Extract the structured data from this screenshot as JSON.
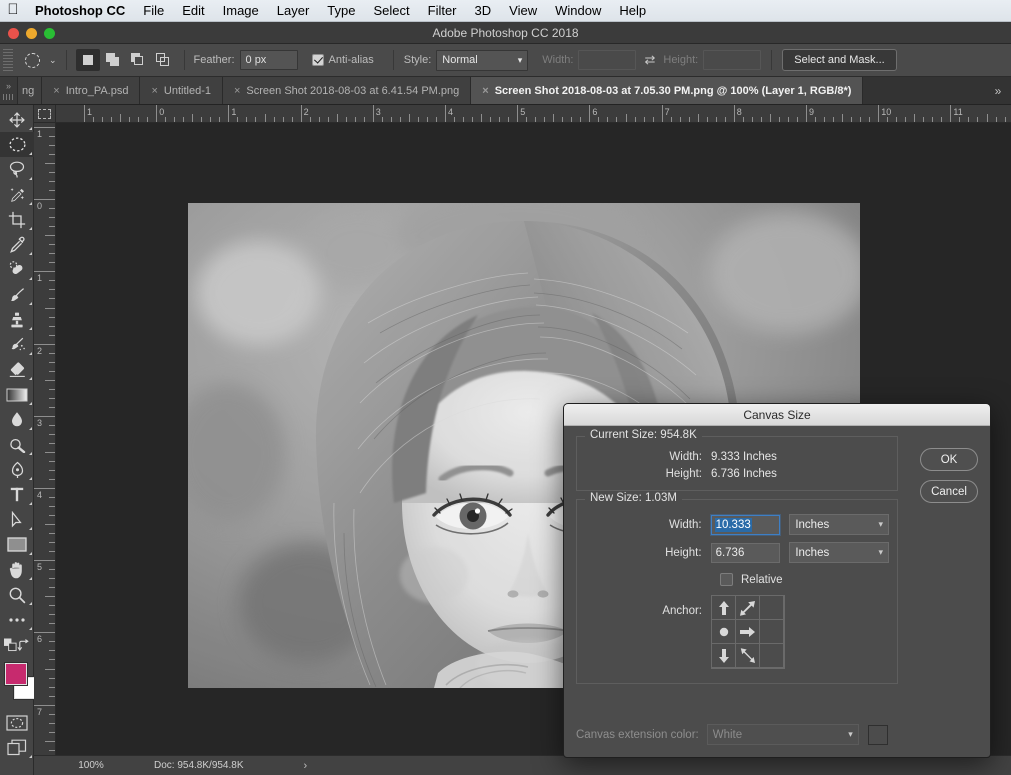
{
  "macmenu": {
    "apple_icon": "apple-logo",
    "items": [
      "Photoshop CC",
      "File",
      "Edit",
      "Image",
      "Layer",
      "Type",
      "Select",
      "Filter",
      "3D",
      "View",
      "Window",
      "Help"
    ]
  },
  "window": {
    "title": "Adobe Photoshop CC 2018",
    "traffic": [
      "close",
      "minimize",
      "zoom"
    ]
  },
  "options_bar": {
    "tool_icon": "elliptical-marquee-icon",
    "tool_chevron": "⌄",
    "selection_modes": [
      "new-selection",
      "add-to-selection",
      "subtract-from-selection",
      "intersect-with-selection"
    ],
    "active_selection_mode": 0,
    "feather_label": "Feather:",
    "feather_value": "0 px",
    "antialias_label": "Anti-alias",
    "antialias_checked": true,
    "style_label": "Style:",
    "style_value": "Normal",
    "width_label": "Width:",
    "width_value": "",
    "swap_icon": "swap-arrows-icon",
    "height_label": "Height:",
    "height_value": "",
    "select_and_mask": "Select and Mask..."
  },
  "tabs": {
    "overflow_left": "»",
    "overflow_right": "»",
    "items": [
      {
        "label": "ng",
        "close": "×",
        "active": false,
        "clipped": true
      },
      {
        "label": "Intro_PA.psd",
        "close": "×",
        "active": false
      },
      {
        "label": "Untitled-1",
        "close": "×",
        "active": false
      },
      {
        "label": "Screen Shot 2018-08-03 at 6.41.54 PM.png",
        "close": "×",
        "active": false
      },
      {
        "label": "Screen Shot 2018-08-03 at 7.05.30 PM.png @ 100% (Layer 1, RGB/8*)",
        "close": "×",
        "active": true
      }
    ]
  },
  "tools": [
    {
      "name": "move-tool",
      "active": false
    },
    {
      "name": "elliptical-marquee-tool",
      "active": true
    },
    {
      "name": "lasso-tool",
      "active": false
    },
    {
      "name": "quick-selection-tool",
      "active": false
    },
    {
      "name": "crop-tool",
      "active": false
    },
    {
      "name": "eyedropper-tool",
      "active": false
    },
    {
      "name": "healing-brush-tool",
      "active": false
    },
    {
      "name": "brush-tool",
      "active": false
    },
    {
      "name": "clone-stamp-tool",
      "active": false
    },
    {
      "name": "history-brush-tool",
      "active": false
    },
    {
      "name": "eraser-tool",
      "active": false
    },
    {
      "name": "gradient-tool",
      "active": false
    },
    {
      "name": "blur-tool",
      "active": false
    },
    {
      "name": "dodge-tool",
      "active": false
    },
    {
      "name": "pen-tool",
      "active": false
    },
    {
      "name": "type-tool",
      "active": false
    },
    {
      "name": "path-selection-tool",
      "active": false
    },
    {
      "name": "rectangle-tool",
      "active": false
    },
    {
      "name": "hand-tool",
      "active": false
    },
    {
      "name": "zoom-tool",
      "active": false
    },
    {
      "name": "edit-toolbar-tool",
      "active": false
    }
  ],
  "colors": {
    "foreground": "#c72a6e",
    "background": "#ffffff",
    "accent_selection": "#2a6ba8",
    "ps_chrome": "#4a4a4a",
    "canvas_backdrop": "#262626"
  },
  "rulers": {
    "units": "inches",
    "horizontal_labels": [
      "1",
      "0",
      "1",
      "2",
      "3",
      "4",
      "5",
      "6",
      "7",
      "8",
      "9",
      "10",
      "11"
    ],
    "vertical_labels": [
      "1",
      "0",
      "1",
      "2",
      "3",
      "4",
      "5",
      "6",
      "7"
    ]
  },
  "canvas": {
    "image_alt": "black-and-white-portrait-of-a-young-girl"
  },
  "status_bar": {
    "zoom": "100%",
    "doc": "Doc: 954.8K/954.8K",
    "arrow": "›"
  },
  "dialog": {
    "title": "Canvas Size",
    "current_size": {
      "legend": "Current Size: 954.8K",
      "rows": [
        {
          "label": "Width:",
          "value": "9.333 Inches"
        },
        {
          "label": "Height:",
          "value": "6.736 Inches"
        }
      ]
    },
    "new_size": {
      "legend": "New Size: 1.03M",
      "width_label": "Width:",
      "width_value": "10.333",
      "width_unit": "Inches",
      "height_label": "Height:",
      "height_value": "6.736",
      "height_unit": "Inches",
      "relative_label": "Relative",
      "relative_checked": false,
      "anchor_label": "Anchor:",
      "anchor_icons": [
        [
          "arrow-up-icon",
          "arrow-up-right-icon",
          ""
        ],
        [
          "anchor-dot-icon",
          "arrow-right-icon",
          ""
        ],
        [
          "arrow-down-icon",
          "arrow-down-right-icon",
          ""
        ]
      ]
    },
    "extension": {
      "label": "Canvas extension color:",
      "value": "White",
      "disabled": true
    },
    "buttons": [
      {
        "label": "OK",
        "name": "ok-button"
      },
      {
        "label": "Cancel",
        "name": "cancel-button"
      }
    ]
  }
}
